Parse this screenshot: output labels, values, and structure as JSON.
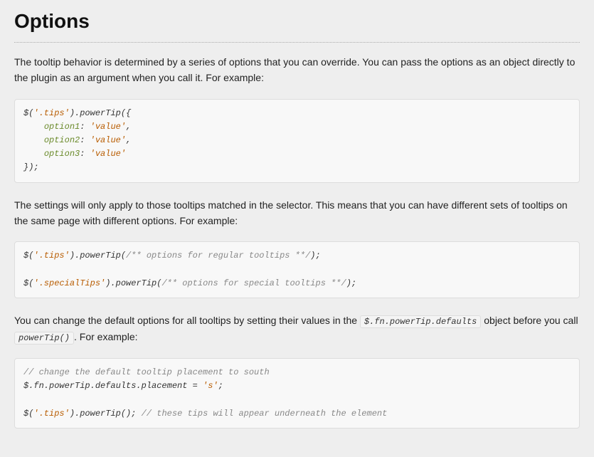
{
  "heading": "Options",
  "para1": "The tooltip behavior is determined by a series of options that you can override. You can pass the options as an object directly to the plugin as an argument when you call it. For example:",
  "code1": {
    "l1a": "$(",
    "l1b": "'.tips'",
    "l1c": ").powerTip({",
    "l2a": "    ",
    "l2b": "option1",
    "l2c": ": ",
    "l2d": "'value'",
    "l2e": ",",
    "l3a": "    ",
    "l3b": "option2",
    "l3c": ": ",
    "l3d": "'value'",
    "l3e": ",",
    "l4a": "    ",
    "l4b": "option3",
    "l4c": ": ",
    "l4d": "'value'",
    "l5": "});"
  },
  "para2": "The settings will only apply to those tooltips matched in the selector. This means that you can have different sets of tooltips on the same page with different options. For example:",
  "code2": {
    "l1a": "$(",
    "l1b": "'.tips'",
    "l1c": ").powerTip(",
    "l1d": "/** options for regular tooltips **/",
    "l1e": ");",
    "l2a": "$(",
    "l2b": "'.specialTips'",
    "l2c": ").powerTip(",
    "l2d": "/** options for special tooltips **/",
    "l2e": ");"
  },
  "para3a": "You can change the default options for all tooltips by setting their values in the ",
  "para3_code1": "$.fn.powerTip.defaults",
  "para3b": " object before you call ",
  "para3_code2": "powerTip()",
  "para3c": ". For example:",
  "code3": {
    "l1": "// change the default tooltip placement to south",
    "l2a": "$.fn.powerTip.defaults.placement = ",
    "l2b": "'s'",
    "l2c": ";",
    "l3a": "$(",
    "l3b": "'.tips'",
    "l3c": ").powerTip(); ",
    "l3d": "// these tips will appear underneath the element"
  }
}
